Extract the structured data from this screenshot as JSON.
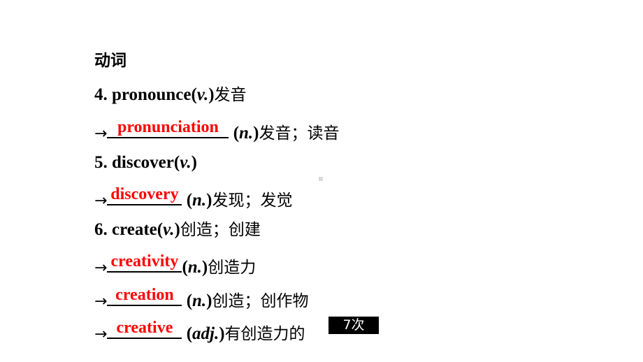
{
  "section_title": "动词",
  "items": [
    {
      "number": "4.",
      "word": "pronounce",
      "pos": "v.",
      "meaning": "发音",
      "derivatives": [
        {
          "answer": "pronunciation",
          "pos": "n.",
          "meaning": "发音；读音"
        }
      ]
    },
    {
      "number": "5.",
      "word": "discover",
      "pos": "v.",
      "meaning": "",
      "derivatives": [
        {
          "answer": "discovery",
          "pos": "n.",
          "meaning": "发现；发觉"
        }
      ]
    },
    {
      "number": "6.",
      "word": "create",
      "pos": "v.",
      "meaning": "创造；创建",
      "derivatives": [
        {
          "answer": "creativity",
          "pos": "n.",
          "meaning": "创造力"
        },
        {
          "answer": "creation",
          "pos": "n.",
          "meaning": "创造；创作物"
        },
        {
          "answer": "creative",
          "pos": "adj.",
          "meaning": "有创造力的"
        }
      ]
    }
  ],
  "arrow": "→",
  "frequency_badge": "7次",
  "colors": {
    "answer": "#ff0000",
    "badge_bg": "#000000",
    "badge_text": "#ffffff"
  }
}
